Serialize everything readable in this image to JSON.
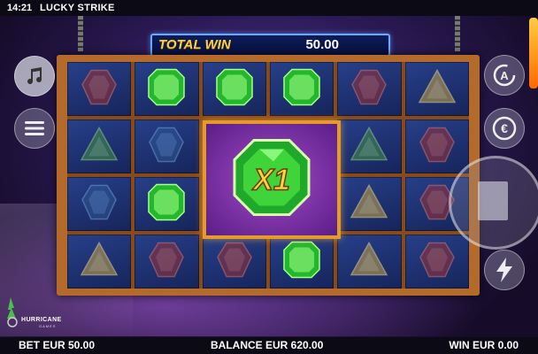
{
  "status_bar": {
    "time": "14:21",
    "game_title": "LUCKY STRIKE"
  },
  "total_win": {
    "label": "TOTAL WIN",
    "value": "50.00"
  },
  "feature": {
    "multiplier": "X1"
  },
  "grid": [
    [
      "red-gem",
      "green-emerald",
      "green-emerald",
      "green-emerald",
      "red-gem",
      "yellow-gem"
    ],
    [
      "green-gem",
      "blue-gem",
      "feature",
      "feature",
      "green-gem",
      "red-gem"
    ],
    [
      "blue-gem",
      "green-emerald",
      "feature",
      "feature",
      "yellow-gem",
      "red-gem"
    ],
    [
      "yellow-gem",
      "red-gem",
      "red-gem",
      "green-emerald",
      "yellow-gem",
      "red-gem"
    ]
  ],
  "logo": {
    "brand": "HURRICANE",
    "sub": "GAMES"
  },
  "bottom_bar": {
    "bet": "BET EUR 50.00",
    "balance": "BALANCE EUR 620.00",
    "win": "WIN EUR 0.00"
  },
  "buttons": {
    "music": "music-note-icon",
    "menu": "hamburger-menu-icon",
    "autoplay": "autoplay-icon",
    "bet_coin": "euro-coin-icon",
    "turbo": "lightning-icon",
    "spin": "stop-icon"
  },
  "colors": {
    "frame": "#b46a2a",
    "banner_label": "#ffd23a",
    "feature_bg": "#8a35b8",
    "cell_bg": "#1f3276"
  }
}
